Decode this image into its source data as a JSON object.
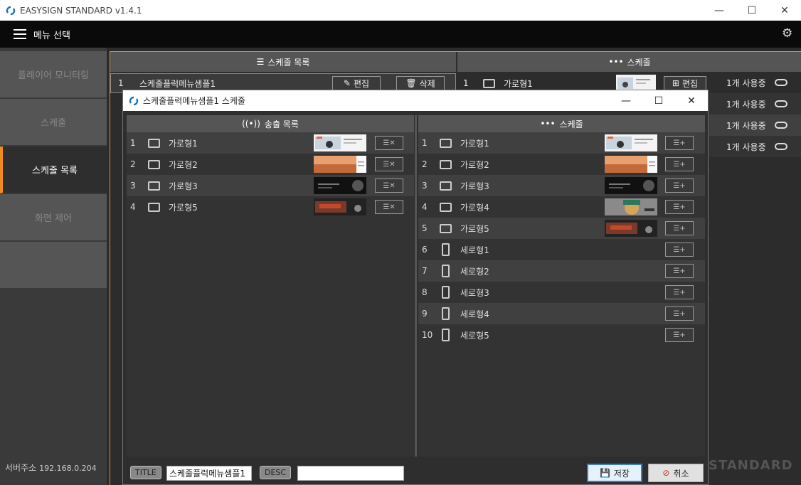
{
  "app": {
    "title": "EASYSIGN STANDARD v1.4.1"
  },
  "window_controls": {
    "minimize": "—",
    "maximize": "☐",
    "close": "✕"
  },
  "menubar": {
    "label": "메뉴 선택"
  },
  "sidebar": {
    "items": [
      {
        "label": "플레이어 모니터링",
        "active": false
      },
      {
        "label": "스케줄",
        "active": false
      },
      {
        "label": "스케줄 목록",
        "active": true
      },
      {
        "label": "화면 제어",
        "active": false
      },
      {
        "label": "",
        "active": false
      }
    ],
    "server_label": "서버주소",
    "server_ip": "192.168.0.204"
  },
  "main": {
    "left_header": "스케줄 목록",
    "right_header": "스케줄",
    "schedule_row": {
      "num": "1",
      "name": "스케줄플럭메뉴샘플1",
      "edit": "편집",
      "delete": "삭제"
    },
    "right_row": {
      "num": "1",
      "name": "가로형1",
      "edit": "편집"
    },
    "usage": [
      "1개 사용중",
      "1개 사용중",
      "1개 사용중",
      "1개 사용중"
    ],
    "brand": "STANDARD"
  },
  "dialog": {
    "title": "스케줄플럭메뉴샘플1 스케줄",
    "left_header": "송출 목록",
    "right_header": "스케줄",
    "broadcast_list": [
      {
        "num": "1",
        "name": "가로형1",
        "thumb": "t1"
      },
      {
        "num": "2",
        "name": "가로형2",
        "thumb": "t2"
      },
      {
        "num": "3",
        "name": "가로형3",
        "thumb": "t3"
      },
      {
        "num": "4",
        "name": "가로형5",
        "thumb": "t5"
      }
    ],
    "schedule_list": [
      {
        "num": "1",
        "name": "가로형1",
        "type": "landscape",
        "thumb": "t1"
      },
      {
        "num": "2",
        "name": "가로형2",
        "type": "landscape",
        "thumb": "t2"
      },
      {
        "num": "3",
        "name": "가로형3",
        "type": "landscape",
        "thumb": "t3"
      },
      {
        "num": "4",
        "name": "가로형4",
        "type": "landscape",
        "thumb": "t4"
      },
      {
        "num": "5",
        "name": "가로형5",
        "type": "landscape",
        "thumb": "t5"
      },
      {
        "num": "6",
        "name": "세로형1",
        "type": "portrait",
        "thumb": ""
      },
      {
        "num": "7",
        "name": "세로형2",
        "type": "portrait",
        "thumb": ""
      },
      {
        "num": "8",
        "name": "세로형3",
        "type": "portrait",
        "thumb": ""
      },
      {
        "num": "9",
        "name": "세로형4",
        "type": "portrait",
        "thumb": ""
      },
      {
        "num": "10",
        "name": "세로형5",
        "type": "portrait",
        "thumb": ""
      }
    ],
    "footer": {
      "title_tag": "TITLE",
      "title_value": "스케줄플럭메뉴샘플1",
      "desc_tag": "DESC",
      "desc_value": "",
      "save": "저장",
      "cancel": "취소"
    }
  },
  "colors": {
    "accent": "#f08c1e",
    "save_border": "#3c7fc7"
  }
}
